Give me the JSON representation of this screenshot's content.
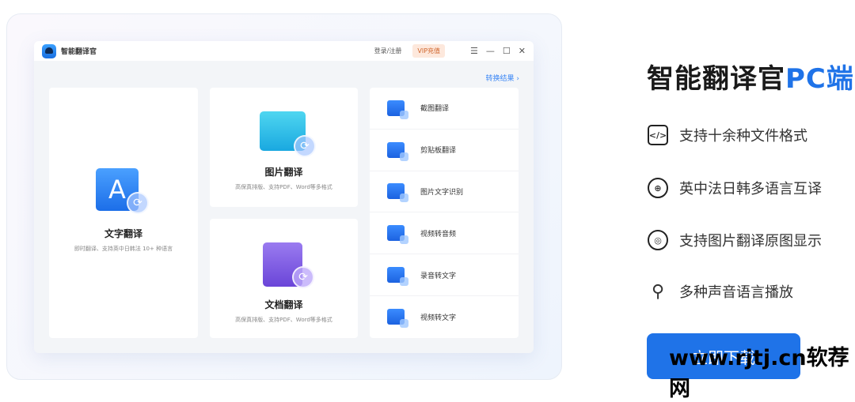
{
  "app": {
    "title": "智能翻译官",
    "login": "登录/注册",
    "vip": "VIP充值",
    "result_link": "转换结果 ›"
  },
  "cards": {
    "text": {
      "title": "文字翻译",
      "desc": "即时翻译、支持英中日韩法 10+ 种语言",
      "icon_letter": "A"
    },
    "image": {
      "title": "图片翻译",
      "desc": "高保真排版、支持PDF、Word等多格式"
    },
    "doc": {
      "title": "文档翻译",
      "desc": "高保真排版、支持PDF、Word等多格式"
    }
  },
  "tools": [
    {
      "label": "截图翻译"
    },
    {
      "label": "剪贴板翻译"
    },
    {
      "label": "图片文字识别"
    },
    {
      "label": "视频转音频"
    },
    {
      "label": "录音转文字"
    },
    {
      "label": "视频转文字"
    }
  ],
  "promo": {
    "title_main": "智能翻译官",
    "title_accent": "PC端",
    "features": [
      {
        "icon": "file-code-icon",
        "glyph": "</>",
        "label": "支持十余种文件格式"
      },
      {
        "icon": "globe-icon",
        "glyph": "⊕",
        "label": "英中法日韩多语言互译"
      },
      {
        "icon": "image-icon",
        "glyph": "◎",
        "label": "支持图片翻译原图显示"
      },
      {
        "icon": "search-icon",
        "glyph": "○",
        "label": "多种声音语言播放"
      }
    ],
    "download": "立即下载"
  },
  "watermark": "www.rjtj.cn软荐网",
  "colors": {
    "accent": "#1f73e8",
    "link": "#3a86f5"
  }
}
